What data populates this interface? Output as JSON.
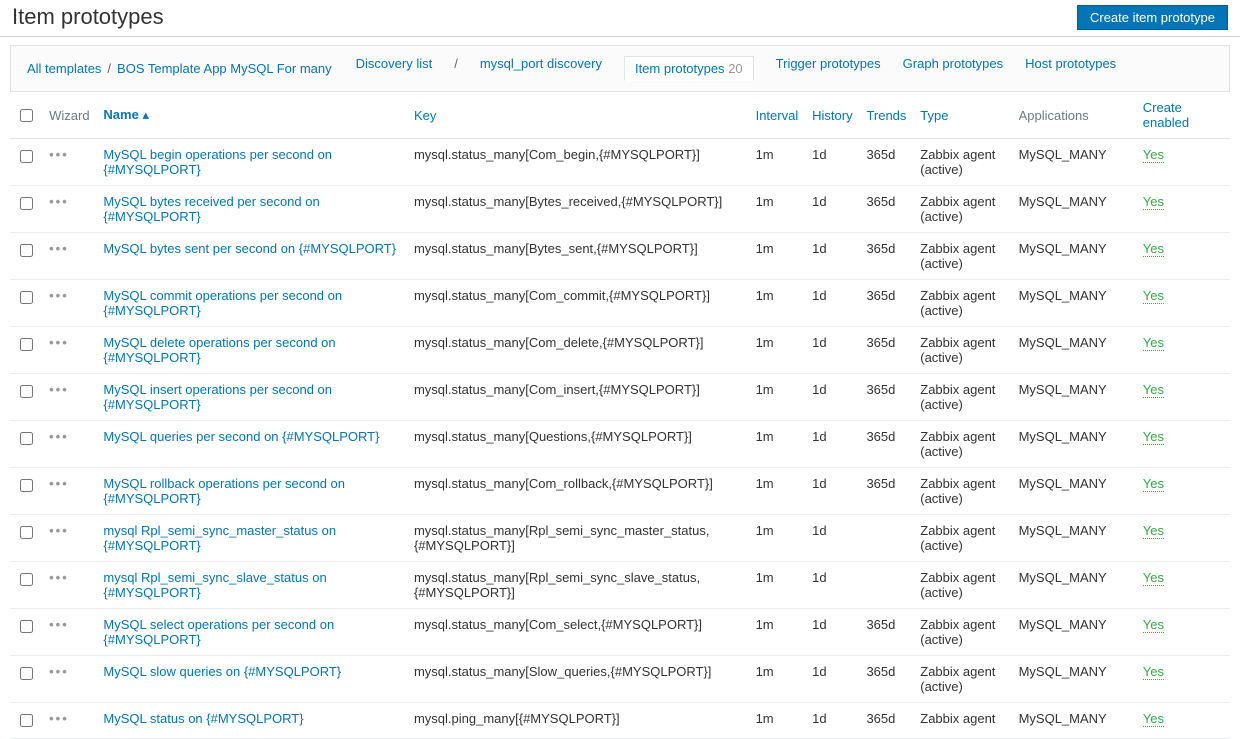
{
  "page": {
    "title": "Item prototypes",
    "createButton": "Create item prototype"
  },
  "breadcrumb": {
    "allTemplates": "All templates",
    "template": "BOS Template App MySQL For many",
    "discoveryList": "Discovery list",
    "discovery": "mysql_port discovery"
  },
  "tabs": {
    "itemProto": "Item prototypes",
    "itemProtoCount": "20",
    "triggerProto": "Trigger prototypes",
    "graphProto": "Graph prototypes",
    "hostProto": "Host prototypes"
  },
  "columns": {
    "wizard": "Wizard",
    "name": "Name",
    "key": "Key",
    "interval": "Interval",
    "history": "History",
    "trends": "Trends",
    "type": "Type",
    "applications": "Applications",
    "createEnabled": "Create enabled"
  },
  "rows": [
    {
      "name": "MySQL begin operations per second on {#MYSQLPORT}",
      "key": "mysql.status_many[Com_begin,{#MYSQLPORT}]",
      "interval": "1m",
      "history": "1d",
      "trends": "365d",
      "type": "Zabbix agent (active)",
      "apps": "MySQL_MANY",
      "enabled": "Yes"
    },
    {
      "name": "MySQL bytes received per second on {#MYSQLPORT}",
      "key": "mysql.status_many[Bytes_received,{#MYSQLPORT}]",
      "interval": "1m",
      "history": "1d",
      "trends": "365d",
      "type": "Zabbix agent (active)",
      "apps": "MySQL_MANY",
      "enabled": "Yes"
    },
    {
      "name": "MySQL bytes sent per second on {#MYSQLPORT}",
      "key": "mysql.status_many[Bytes_sent,{#MYSQLPORT}]",
      "interval": "1m",
      "history": "1d",
      "trends": "365d",
      "type": "Zabbix agent (active)",
      "apps": "MySQL_MANY",
      "enabled": "Yes"
    },
    {
      "name": "MySQL commit operations per second on {#MYSQLPORT}",
      "key": "mysql.status_many[Com_commit,{#MYSQLPORT}]",
      "interval": "1m",
      "history": "1d",
      "trends": "365d",
      "type": "Zabbix agent (active)",
      "apps": "MySQL_MANY",
      "enabled": "Yes"
    },
    {
      "name": "MySQL delete operations per second on {#MYSQLPORT}",
      "key": "mysql.status_many[Com_delete,{#MYSQLPORT}]",
      "interval": "1m",
      "history": "1d",
      "trends": "365d",
      "type": "Zabbix agent (active)",
      "apps": "MySQL_MANY",
      "enabled": "Yes"
    },
    {
      "name": "MySQL insert operations per second on {#MYSQLPORT}",
      "key": "mysql.status_many[Com_insert,{#MYSQLPORT}]",
      "interval": "1m",
      "history": "1d",
      "trends": "365d",
      "type": "Zabbix agent (active)",
      "apps": "MySQL_MANY",
      "enabled": "Yes"
    },
    {
      "name": "MySQL queries per second on {#MYSQLPORT}",
      "key": "mysql.status_many[Questions,{#MYSQLPORT}]",
      "interval": "1m",
      "history": "1d",
      "trends": "365d",
      "type": "Zabbix agent (active)",
      "apps": "MySQL_MANY",
      "enabled": "Yes"
    },
    {
      "name": "MySQL rollback operations per second on {#MYSQLPORT}",
      "key": "mysql.status_many[Com_rollback,{#MYSQLPORT}]",
      "interval": "1m",
      "history": "1d",
      "trends": "365d",
      "type": "Zabbix agent (active)",
      "apps": "MySQL_MANY",
      "enabled": "Yes"
    },
    {
      "name": "mysql Rpl_semi_sync_master_status on {#MYSQLPORT}",
      "key": "mysql.status_many[Rpl_semi_sync_master_status,{#MYSQLPORT}]",
      "interval": "1m",
      "history": "1d",
      "trends": "",
      "type": "Zabbix agent (active)",
      "apps": "MySQL_MANY",
      "enabled": "Yes"
    },
    {
      "name": "mysql Rpl_semi_sync_slave_status on {#MYSQLPORT}",
      "key": "mysql.status_many[Rpl_semi_sync_slave_status,{#MYSQLPORT}]",
      "interval": "1m",
      "history": "1d",
      "trends": "",
      "type": "Zabbix agent (active)",
      "apps": "MySQL_MANY",
      "enabled": "Yes"
    },
    {
      "name": "MySQL select operations per second on {#MYSQLPORT}",
      "key": "mysql.status_many[Com_select,{#MYSQLPORT}]",
      "interval": "1m",
      "history": "1d",
      "trends": "365d",
      "type": "Zabbix agent (active)",
      "apps": "MySQL_MANY",
      "enabled": "Yes"
    },
    {
      "name": "MySQL slow queries on {#MYSQLPORT}",
      "key": "mysql.status_many[Slow_queries,{#MYSQLPORT}]",
      "interval": "1m",
      "history": "1d",
      "trends": "365d",
      "type": "Zabbix agent (active)",
      "apps": "MySQL_MANY",
      "enabled": "Yes"
    },
    {
      "name": "MySQL status on {#MYSQLPORT}",
      "key": "mysql.ping_many[{#MYSQLPORT}]",
      "interval": "1m",
      "history": "1d",
      "trends": "365d",
      "type": "Zabbix agent",
      "apps": "MySQL_MANY",
      "enabled": "Yes"
    }
  ]
}
